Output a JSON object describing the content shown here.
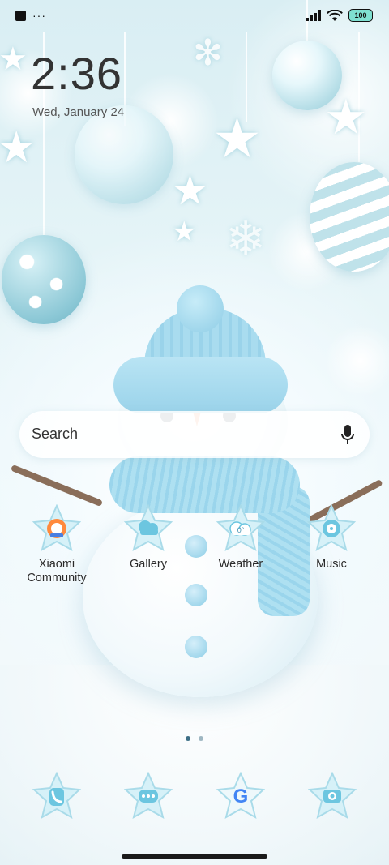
{
  "status_bar": {
    "battery": "100",
    "icons": [
      "notification-square-icon",
      "more-dots-icon",
      "signal-icon",
      "wifi-icon",
      "battery-icon"
    ]
  },
  "clock": {
    "time": "2:36",
    "date": "Wed, January 24"
  },
  "search": {
    "placeholder": "Search",
    "icon": "mic-icon"
  },
  "apps": [
    {
      "label": "Xiaomi\nCommunity",
      "icon": "xiaomi-community-icon"
    },
    {
      "label": "Gallery",
      "icon": "gallery-icon"
    },
    {
      "label": "Weather",
      "icon": "weather-icon",
      "badge": "0°"
    },
    {
      "label": "Music",
      "icon": "music-icon"
    }
  ],
  "dock": [
    {
      "icon": "phone-icon"
    },
    {
      "icon": "messages-icon"
    },
    {
      "icon": "google-icon",
      "glyph": "G"
    },
    {
      "icon": "camera-icon"
    }
  ],
  "pager": {
    "pages": 2,
    "current": 1
  },
  "colors": {
    "accent": "#7fd3e6",
    "text": "#333333",
    "pager_active": "#3d6f86",
    "pager_inactive": "#9fb7c2"
  }
}
